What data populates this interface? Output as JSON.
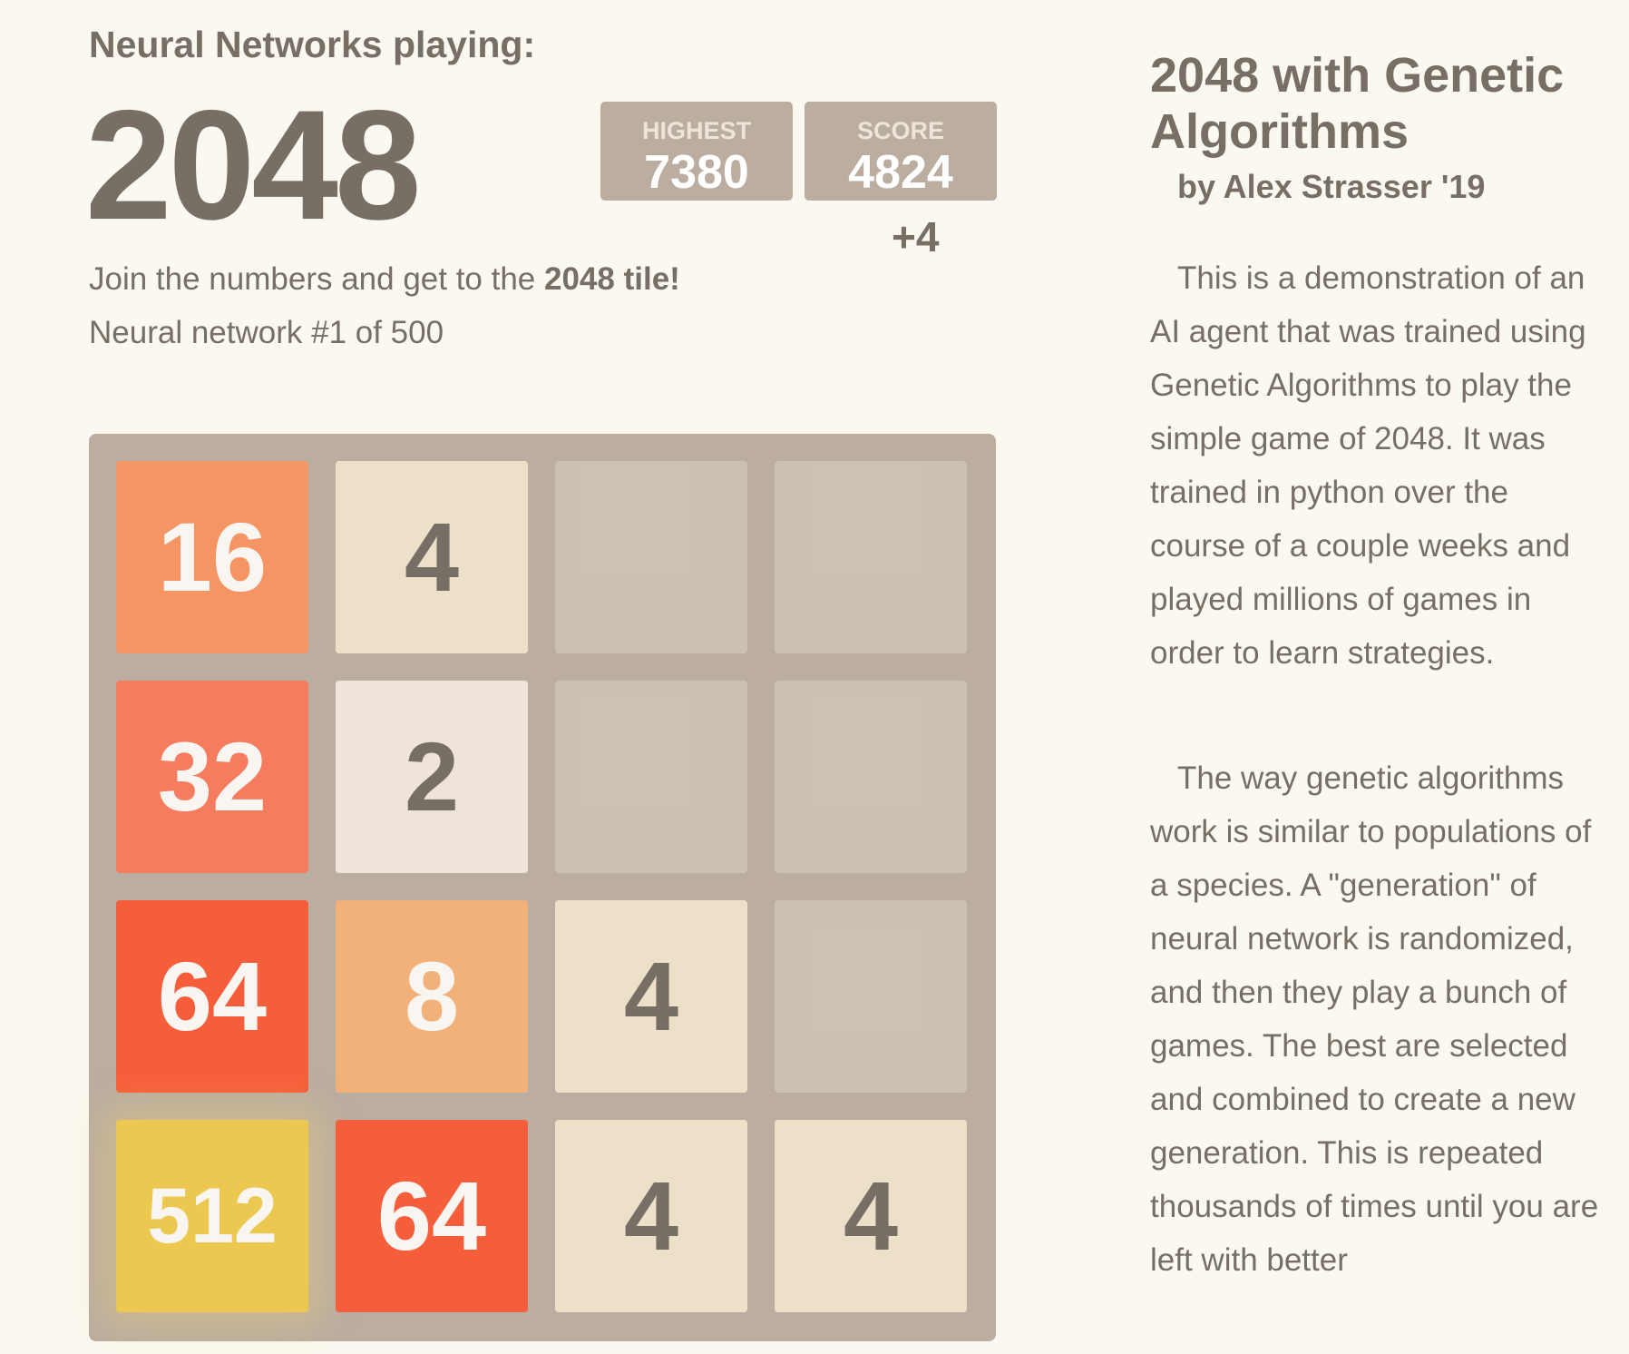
{
  "header": {
    "kicker": "Neural Networks playing:",
    "title": "2048"
  },
  "scores": {
    "highest_label": "HIGHEST",
    "highest_value": "7380",
    "score_label": "SCORE",
    "score_value": "4824",
    "score_addition": "+4"
  },
  "intro": {
    "prefix": "Join the numbers and get to the ",
    "highlight": "2048 tile!",
    "network_info": "Neural network #1 of 500"
  },
  "board": {
    "grid": [
      [
        "16",
        "4",
        "",
        ""
      ],
      [
        "32",
        "2",
        "",
        ""
      ],
      [
        "64",
        "8",
        "4",
        ""
      ],
      [
        "512",
        "64",
        "4",
        "4"
      ]
    ]
  },
  "sidebar": {
    "title": "2048 with Genetic Algorithms",
    "byline": "by Alex Strasser '19",
    "paragraph_1": "This is a demonstration of an AI agent that was trained using Genetic Algorithms to play the simple game of 2048. It was trained in python over the course of a couple weeks and played millions of games in order to learn strategies.",
    "paragraph_2": "The way genetic algorithms work is similar to populations of a species. A \"generation\" of neural network is randomized, and then they play a bunch of games. The best are selected and combined to create a new generation. This is repeated thousands of times until you are left with better"
  },
  "colors": {
    "background": "#faf8ef",
    "text": "#776e65",
    "board": "#bbada0",
    "tile_2": "#eee4da",
    "tile_4": "#ede0c8",
    "tile_8": "#f2b179",
    "tile_16": "#f59563",
    "tile_32": "#f67c5f",
    "tile_64": "#f65e3b",
    "tile_512": "#edc850"
  }
}
